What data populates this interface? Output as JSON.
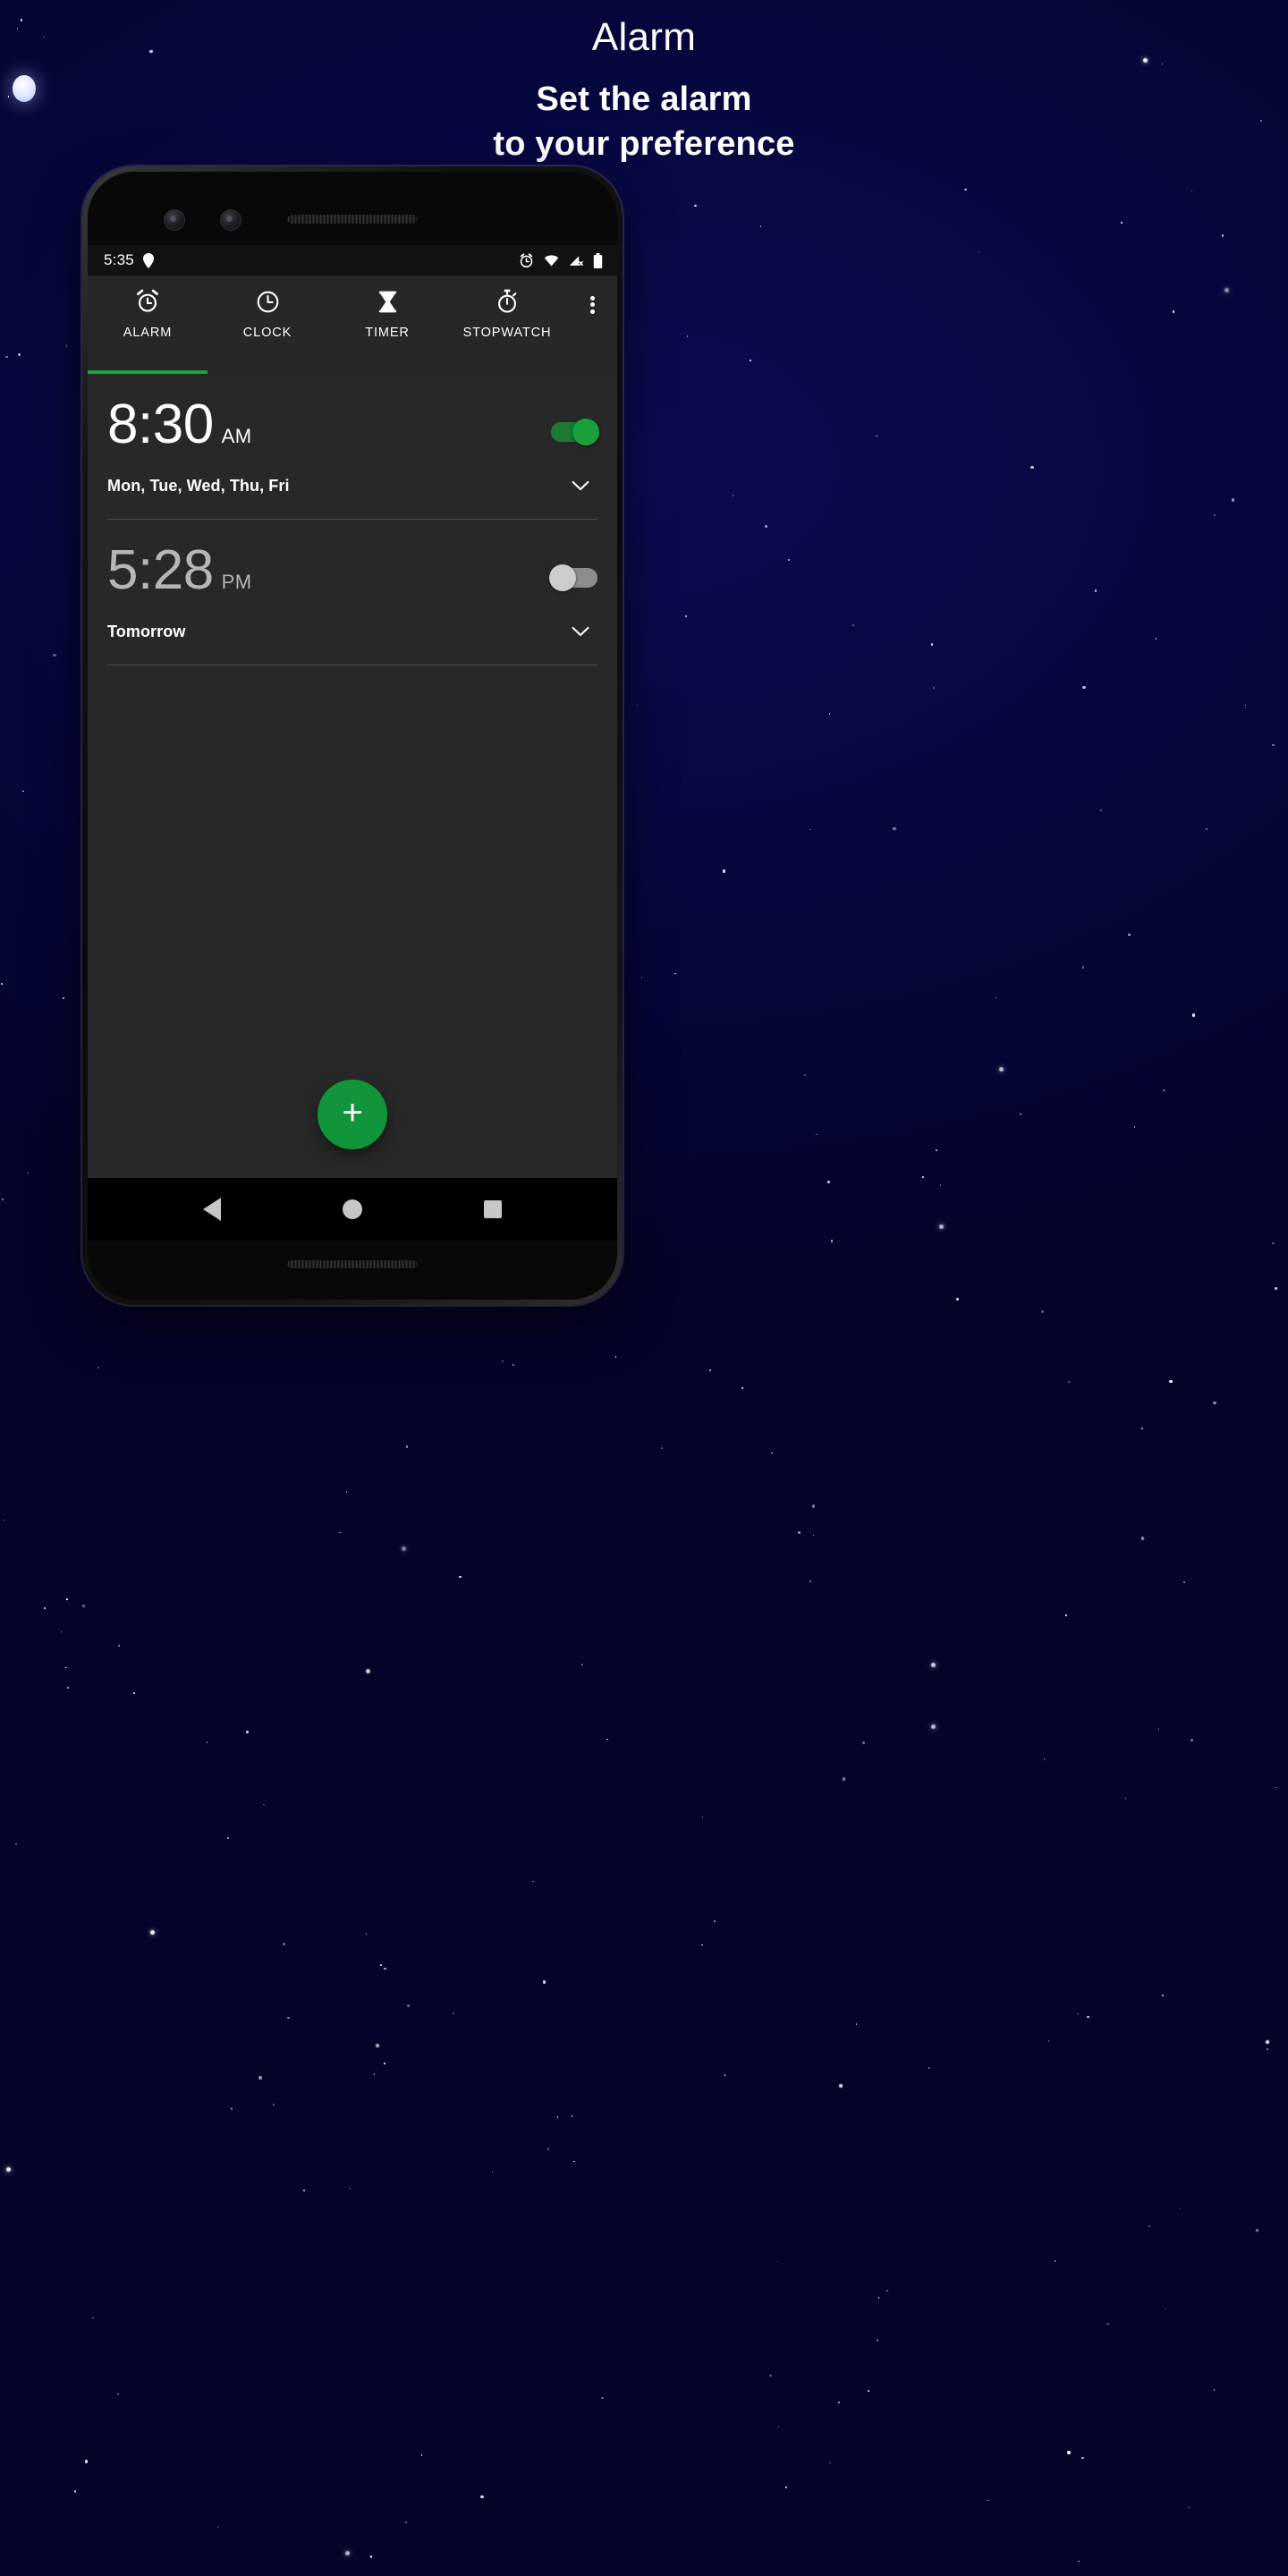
{
  "header": {
    "title": "Alarm",
    "subtitle_line1": "Set the alarm",
    "subtitle_line2": "to your preference"
  },
  "colors": {
    "background": "#050535",
    "accent_green": "#21a038",
    "fab_green": "#12943a",
    "screen_bg": "#282828",
    "tabbar_bg": "#272727",
    "statusbar_bg": "#121212",
    "divider": "#4d4d4d",
    "toggle_on_track": "#1d7a33",
    "toggle_on_thumb": "#1aa03a",
    "toggle_off_track": "#8d8d8d",
    "toggle_off_thumb": "#cdcdcd",
    "time_on": "#ffffff",
    "time_off": "#b6b6b6"
  },
  "status_bar": {
    "clock": "5:35",
    "left_icons": [
      "location-pin-icon"
    ],
    "right_icons": [
      "alarm-set-icon",
      "wifi-icon",
      "cellular-no-sim-icon",
      "battery-full-icon"
    ]
  },
  "tabs": [
    {
      "label": "ALARM",
      "icon": "alarm-clock-icon",
      "selected": true
    },
    {
      "label": "CLOCK",
      "icon": "clock-icon",
      "selected": false
    },
    {
      "label": "TIMER",
      "icon": "hourglass-icon",
      "selected": false
    },
    {
      "label": "STOPWATCH",
      "icon": "stopwatch-icon",
      "selected": false
    }
  ],
  "overflow_menu": {
    "icon": "more-vertical-icon"
  },
  "alarms": [
    {
      "time": "8:30",
      "meridiem": "AM",
      "schedule": "Mon, Tue, Wed, Thu, Fri",
      "enabled": true,
      "expand_icon": "chevron-down-icon"
    },
    {
      "time": "5:28",
      "meridiem": "PM",
      "schedule": "Tomorrow",
      "enabled": false,
      "expand_icon": "chevron-down-icon"
    }
  ],
  "fab": {
    "label": "+",
    "icon": "plus-icon"
  },
  "nav_bar": {
    "back": "back-triangle-icon",
    "home": "home-circle-icon",
    "recents": "recents-square-icon"
  }
}
